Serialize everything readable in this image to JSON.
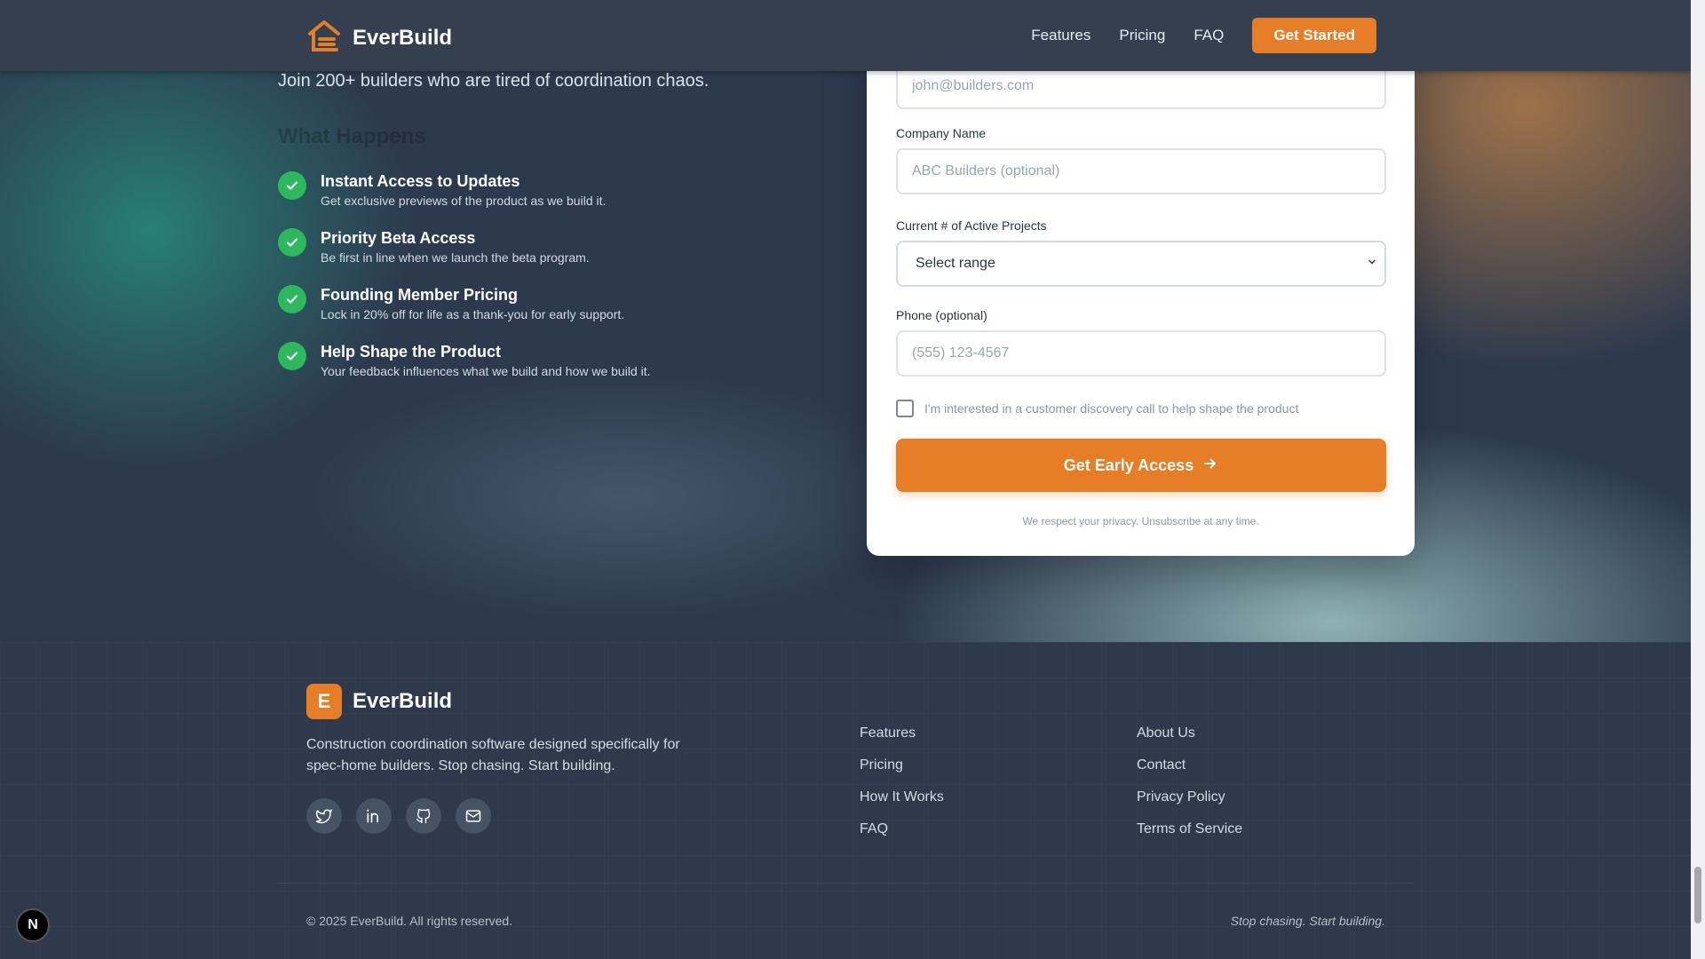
{
  "brand": {
    "name": "EverBuild",
    "footer_logo_letter": "E",
    "accent": "#e57e26"
  },
  "nav": {
    "links": [
      "Features",
      "Pricing",
      "FAQ"
    ],
    "cta": "Get Started"
  },
  "hero": {
    "subtitle": "Join 200+ builders who are tired of coordination chaos.",
    "section_heading": "What Happens",
    "benefits": [
      {
        "title": "Instant Access to Updates",
        "desc": "Get exclusive previews of the product as we build it."
      },
      {
        "title": "Priority Beta Access",
        "desc": "Be first in line when we launch the beta program."
      },
      {
        "title": "Founding Member Pricing",
        "desc": "Lock in 20% off for life as a thank-you for early support."
      },
      {
        "title": "Help Shape the Product",
        "desc": "Your feedback influences what we build and how we build it."
      }
    ]
  },
  "form": {
    "email_placeholder": "john@builders.com",
    "company_label": "Company Name",
    "company_placeholder": "ABC Builders (optional)",
    "projects_label": "Current # of Active Projects",
    "projects_selected": "Select range",
    "phone_label": "Phone (optional)",
    "phone_placeholder": "(555) 123-4567",
    "discovery_checkbox_label": "I'm interested in a customer discovery call to help shape the product",
    "discovery_checked": false,
    "submit_label": "Get Early Access",
    "privacy_note": "We respect your privacy. Unsubscribe at any time."
  },
  "footer": {
    "description": "Construction coordination software designed specifically for spec-home builders. Stop chasing. Start building.",
    "socials": [
      "twitter-icon",
      "linkedin-icon",
      "github-icon",
      "mail-icon"
    ],
    "col1": [
      "Features",
      "Pricing",
      "How It Works",
      "FAQ"
    ],
    "col2": [
      "About Us",
      "Contact",
      "Privacy Policy",
      "Terms of Service"
    ],
    "copyright": "© 2025 EverBuild. All rights reserved.",
    "tagline": "Stop chasing. Start building."
  },
  "dev_badge": "N"
}
